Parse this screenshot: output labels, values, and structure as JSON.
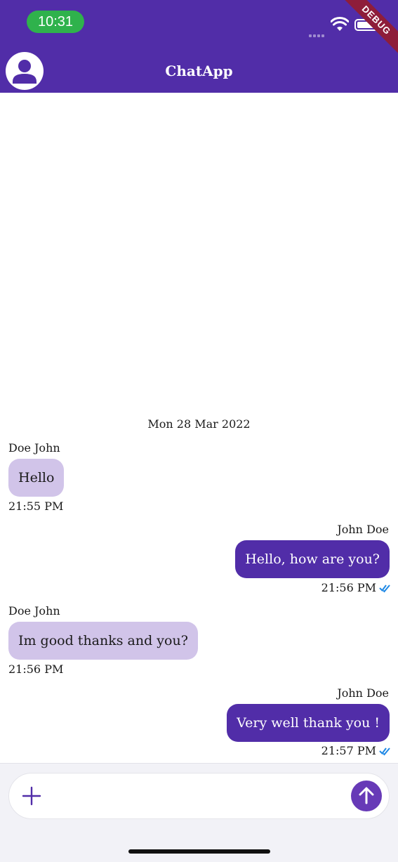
{
  "status_bar": {
    "time": "10:31",
    "debug_label": "DEBUG"
  },
  "app_bar": {
    "title": "ChatApp"
  },
  "colors": {
    "primary": "#512da8",
    "incoming_bubble": "#d1c4e9",
    "read_check": "#1e88e5",
    "time_pill": "#2fb24c"
  },
  "chat": {
    "date_separator": "Mon 28 Mar 2022",
    "messages": [
      {
        "sender": "Doe John",
        "text": "Hello",
        "time": "21:55 PM",
        "direction": "incoming",
        "read": false
      },
      {
        "sender": "John Doe",
        "text": "Hello, how are you?",
        "time": "21:56 PM",
        "direction": "outgoing",
        "read": true
      },
      {
        "sender": "Doe John",
        "text": "Im good thanks and you?",
        "time": "21:56 PM",
        "direction": "incoming",
        "read": false
      },
      {
        "sender": "John Doe",
        "text": "Very well thank you !",
        "time": "21:57 PM",
        "direction": "outgoing",
        "read": true
      }
    ]
  },
  "composer": {
    "placeholder": "",
    "value": "",
    "add_icon": "plus-icon",
    "send_icon": "arrow-up-icon"
  }
}
